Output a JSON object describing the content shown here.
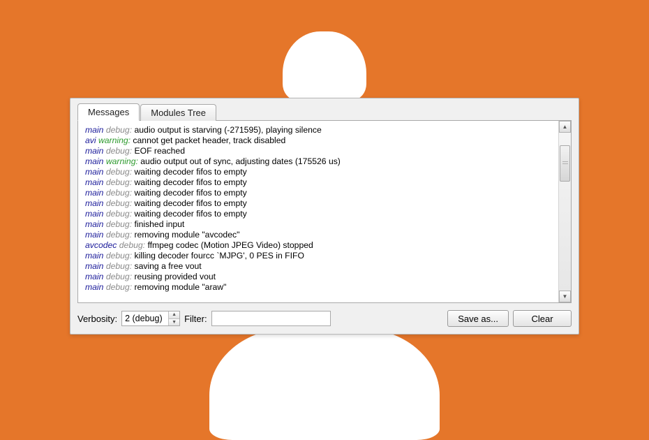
{
  "tabs": [
    {
      "label": "Messages",
      "active": true
    },
    {
      "label": "Modules Tree",
      "active": false
    }
  ],
  "log": [
    {
      "source": "main",
      "level": "debug",
      "message": "audio output is starving (-271595), playing silence"
    },
    {
      "source": "avi",
      "level": "warning",
      "message": "cannot get packet header, track disabled"
    },
    {
      "source": "main",
      "level": "debug",
      "message": "EOF reached"
    },
    {
      "source": "main",
      "level": "warning",
      "message": "audio output out of sync, adjusting dates (175526 us)"
    },
    {
      "source": "main",
      "level": "debug",
      "message": "waiting decoder fifos to empty"
    },
    {
      "source": "main",
      "level": "debug",
      "message": "waiting decoder fifos to empty"
    },
    {
      "source": "main",
      "level": "debug",
      "message": "waiting decoder fifos to empty"
    },
    {
      "source": "main",
      "level": "debug",
      "message": "waiting decoder fifos to empty"
    },
    {
      "source": "main",
      "level": "debug",
      "message": "waiting decoder fifos to empty"
    },
    {
      "source": "main",
      "level": "debug",
      "message": "finished input"
    },
    {
      "source": "main",
      "level": "debug",
      "message": "removing module \"avcodec\""
    },
    {
      "source": "avcodec",
      "level": "debug",
      "message": "ffmpeg codec (Motion JPEG Video) stopped"
    },
    {
      "source": "main",
      "level": "debug",
      "message": "killing decoder fourcc `MJPG', 0 PES in FIFO"
    },
    {
      "source": "main",
      "level": "debug",
      "message": "saving a free vout"
    },
    {
      "source": "main",
      "level": "debug",
      "message": "reusing provided vout"
    },
    {
      "source": "main",
      "level": "debug",
      "message": "removing module \"araw\""
    }
  ],
  "controls": {
    "verbosity_label": "Verbosity:",
    "verbosity_value": "2 (debug)",
    "filter_label": "Filter:",
    "filter_value": "",
    "save_label": "Save as...",
    "clear_label": "Clear"
  }
}
